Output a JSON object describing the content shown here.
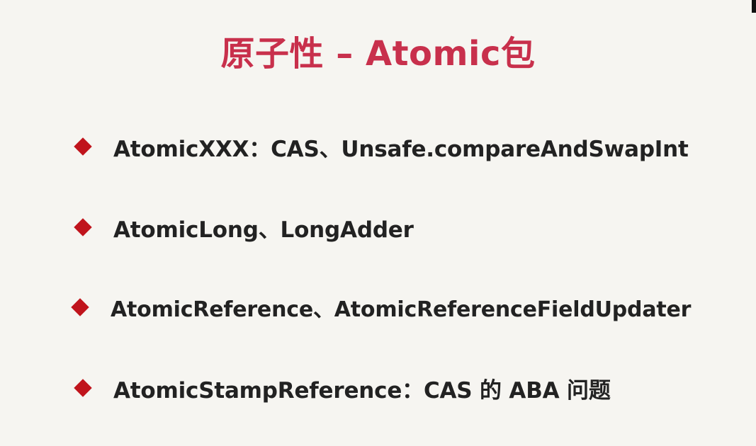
{
  "slide": {
    "title": "原子性 – Atomic包",
    "accent_color": "#c8304c",
    "bullet_color": "#c0141c",
    "bullets": [
      {
        "text": "AtomicXXX：CAS、Unsafe.compareAndSwapInt"
      },
      {
        "text": "AtomicLong、LongAdder"
      },
      {
        "text": "AtomicReference、AtomicReferenceFieldUpdater"
      },
      {
        "text": "AtomicStampReference：CAS 的 ABA 问题"
      }
    ]
  }
}
